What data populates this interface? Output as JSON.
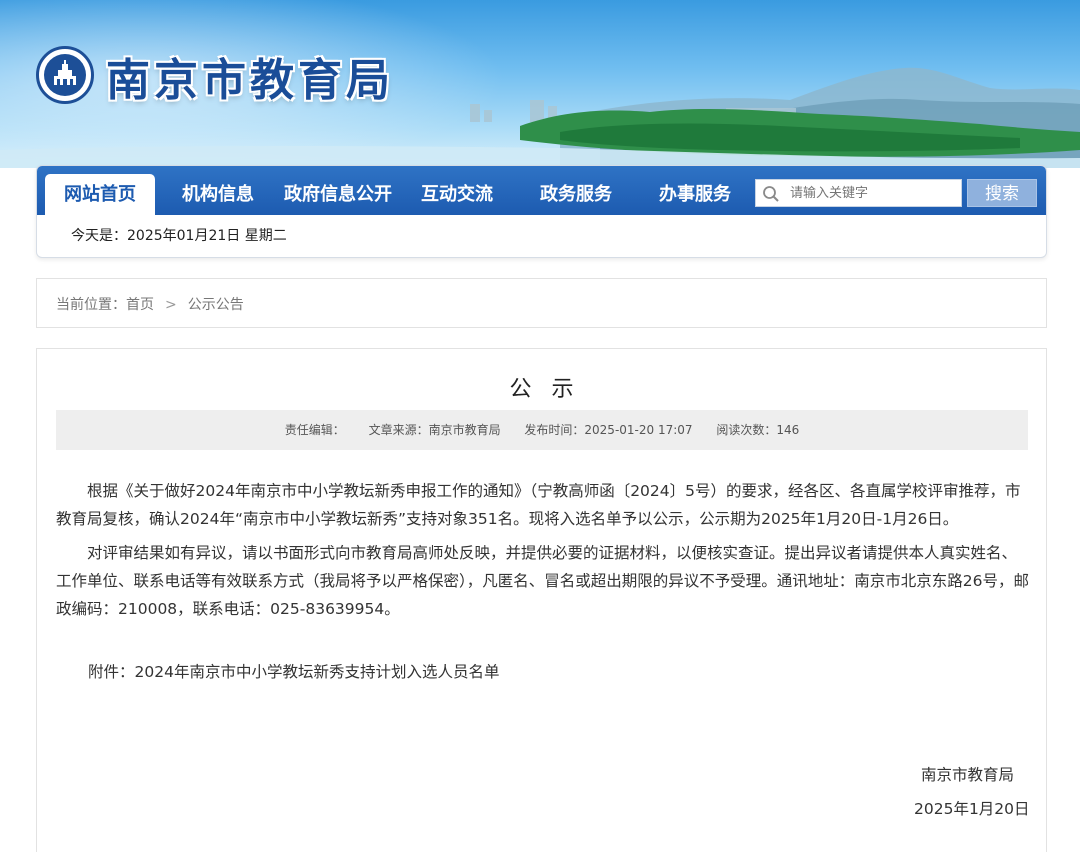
{
  "site": {
    "title": "南京市教育局",
    "emblem": "nanjing-emblem-icon"
  },
  "nav": {
    "items": [
      {
        "label": "网站首页",
        "active": true
      },
      {
        "label": "机构信息",
        "active": false
      },
      {
        "label": "政府信息公开",
        "active": false
      },
      {
        "label": "互动交流",
        "active": false
      },
      {
        "label": "政务服务",
        "active": false
      },
      {
        "label": "办事服务",
        "active": false
      }
    ],
    "search_placeholder": "请输入关键字",
    "search_button": "搜索",
    "date_text": "今天是：2025年01月21日  星期二"
  },
  "breadcrumb": {
    "prefix": "当前位置：",
    "home": "首页",
    "separator": ">",
    "current": "公示公告"
  },
  "article": {
    "title": "公示",
    "meta": {
      "editor": "责任编辑：",
      "source": "文章来源：南京市教育局",
      "published": "发布时间：2025-01-20 17:07",
      "views": "阅读次数：146"
    },
    "paragraphs": [
      "根据《关于做好2024年南京市中小学教坛新秀申报工作的通知》（宁教高师函〔2024〕5号）的要求，经各区、各直属学校评审推荐，市教育局复核，确认2024年“南京市中小学教坛新秀”支持对象351名。现将入选名单予以公示，公示期为2025年1月20日-1月26日。",
      "对评审结果如有异议，请以书面形式向市教育局高师处反映，并提供必要的证据材料，以便核实查证。提出异议者请提供本人真实姓名、工作单位、联系电话等有效联系方式（我局将予以严格保密），凡匿名、冒名或超出期限的异议不予受理。通讯地址：南京市北京东路26号，邮政编码：210008，联系电话：025-83639954。"
    ],
    "attachment": "附件：2024年南京市中小学教坛新秀支持计划入选人员名单",
    "signature_org": "南京市教育局",
    "signature_date": "2025年1月20日"
  },
  "colors": {
    "nav_blue": "#1d5bb0",
    "title_blue": "#1a4d98",
    "search_button": "#8fb1dd"
  }
}
